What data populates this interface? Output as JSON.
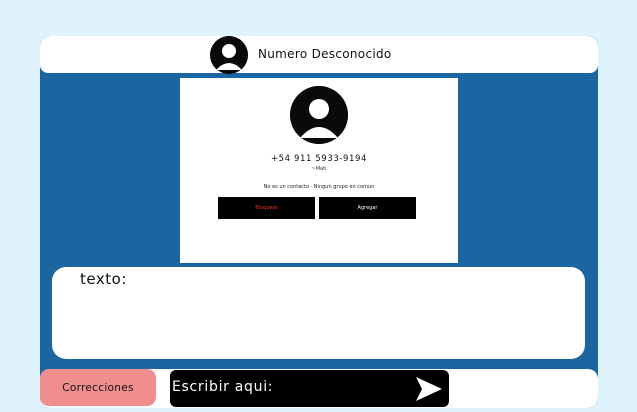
{
  "header": {
    "title": "Numero Desconocido",
    "avatar_icon": "user-avatar-icon"
  },
  "contact": {
    "avatar_icon": "user-avatar-icon",
    "phone": "+54 911 5933-9194",
    "alias": "~Mati",
    "info": "No es un contacto · Ningun grupo en comun",
    "block_label": "Bloquear",
    "add_label": "Agregar"
  },
  "text_box": {
    "label": "texto:"
  },
  "footer": {
    "corrections_label": "Correcciones",
    "input_label": "Escribir aqui:",
    "send_icon": "send-arrow-icon"
  },
  "colors": {
    "page_bg": "#dff3fc",
    "app_bg": "#1b66a0",
    "block_text": "#ff2a2a",
    "corrections_bg": "#f08e8e"
  }
}
